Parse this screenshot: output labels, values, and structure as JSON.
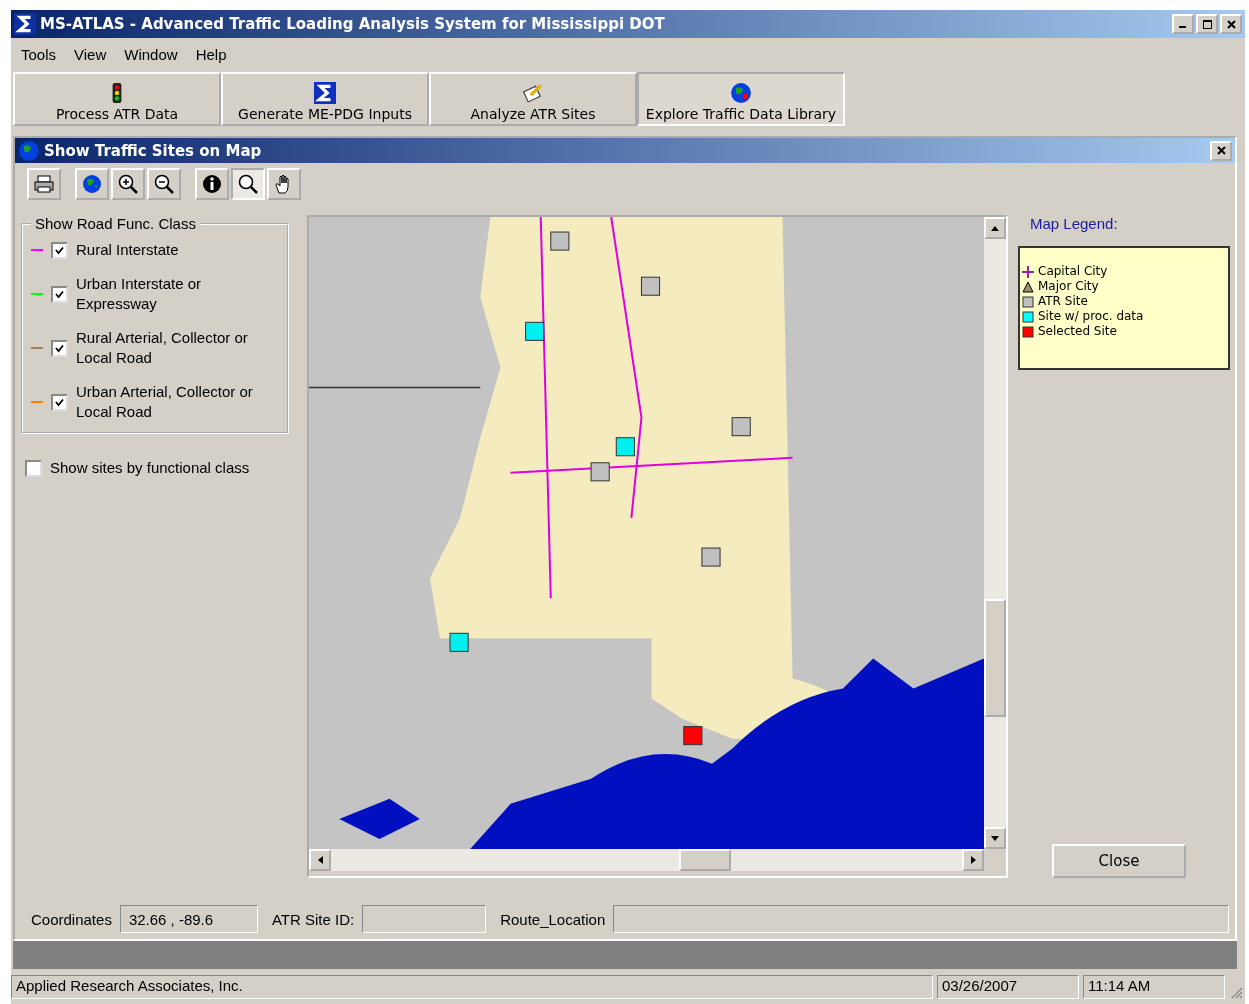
{
  "window": {
    "title": "MS-ATLAS - Advanced Traffic Loading Analysis System for Mississippi DOT"
  },
  "menu": [
    "Tools",
    "View",
    "Window",
    "Help"
  ],
  "modules": [
    {
      "label": "Process ATR Data",
      "selected": false
    },
    {
      "label": "Generate ME-PDG Inputs",
      "selected": false
    },
    {
      "label": "Analyze ATR Sites",
      "selected": false
    },
    {
      "label": "Explore Traffic Data Library",
      "selected": true
    }
  ],
  "map_window": {
    "title": "Show Traffic Sites on Map",
    "tools": [
      {
        "kind": "print",
        "selected": false
      },
      {
        "kind": "globe",
        "selected": false
      },
      {
        "kind": "zoom-in",
        "selected": false
      },
      {
        "kind": "zoom-out",
        "selected": false
      },
      {
        "kind": "info",
        "selected": false
      },
      {
        "kind": "search",
        "selected": true
      },
      {
        "kind": "pan",
        "selected": false
      }
    ],
    "road_class": {
      "title": "Show Road Func. Class",
      "items": [
        {
          "label": "Rural Interstate",
          "color": "#ff00ff",
          "checked": true
        },
        {
          "label": "Urban Interstate or Expressway",
          "color": "#00ff00",
          "checked": true
        },
        {
          "label": "Rural Arterial, Collector or Local Road",
          "color": "#a08060",
          "checked": true
        },
        {
          "label": "Urban Arterial, Collector or Local Road",
          "color": "#ff8000",
          "checked": true
        }
      ]
    },
    "by_class": {
      "label": "Show sites by functional class",
      "checked": false
    },
    "legend": {
      "title": "Map Legend:",
      "items": [
        {
          "kind": "cross",
          "label": "Capital City",
          "color": "#a020a0"
        },
        {
          "kind": "triangle",
          "label": "Major City",
          "color": "#a09070"
        },
        {
          "kind": "square",
          "label": "ATR Site",
          "color": "#c0c0c0"
        },
        {
          "kind": "square",
          "label": "Site w/ proc. data",
          "color": "#00ffff"
        },
        {
          "kind": "square",
          "label": "Selected Site",
          "color": "#ff0000"
        }
      ]
    },
    "close_button": "Close",
    "fields": [
      {
        "label": "Coordinates",
        "value": "32.66 , -89.6"
      },
      {
        "label": "ATR Site ID:"
      },
      {
        "label": "Route_Location"
      }
    ]
  },
  "status_bar": [
    "Applied Research Associates, Inc.",
    "03/26/2007",
    "11:14 AM"
  ]
}
